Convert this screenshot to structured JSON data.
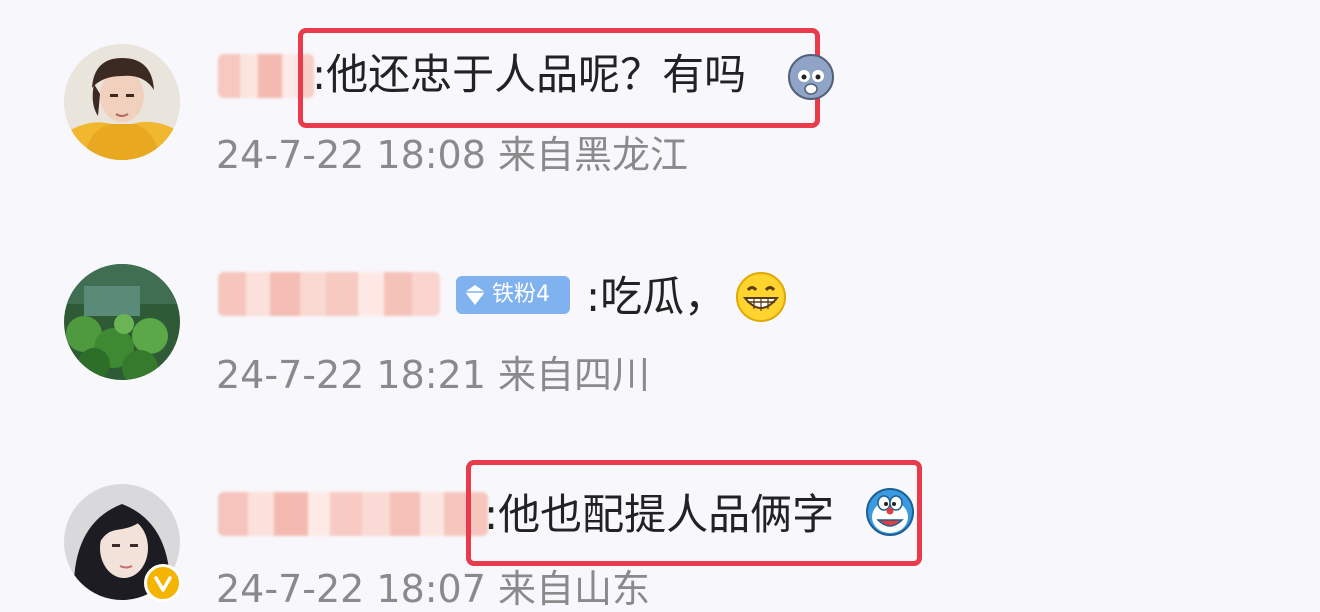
{
  "comments": [
    {
      "text": ":他还忠于人品呢？有吗",
      "timestamp": "24-7-22 18:08 来自黑龙江",
      "avatar": "avatar-man-yellow-hoodie",
      "emoji": "scared-face-emoji",
      "highlighted": true
    },
    {
      "text": ":吃瓜，",
      "timestamp": "24-7-22 18:21 来自四川",
      "avatar": "avatar-green-garden",
      "emoji": "grinning-face-emoji",
      "badge": "铁粉4",
      "highlighted": false
    },
    {
      "text": ":他也配提人品俩字",
      "timestamp": "24-7-22 18:07 来自山东",
      "avatar": "avatar-woman-dark-hair",
      "emoji": "doraemon-emoji",
      "verified": true,
      "highlighted": true
    }
  ],
  "colors": {
    "background": "#f8f7fb",
    "highlight_border": "#ea3b4d",
    "timestamp": "#8a8a8a",
    "badge": "#7fb2ef",
    "verified_badge": "#f5b400"
  }
}
